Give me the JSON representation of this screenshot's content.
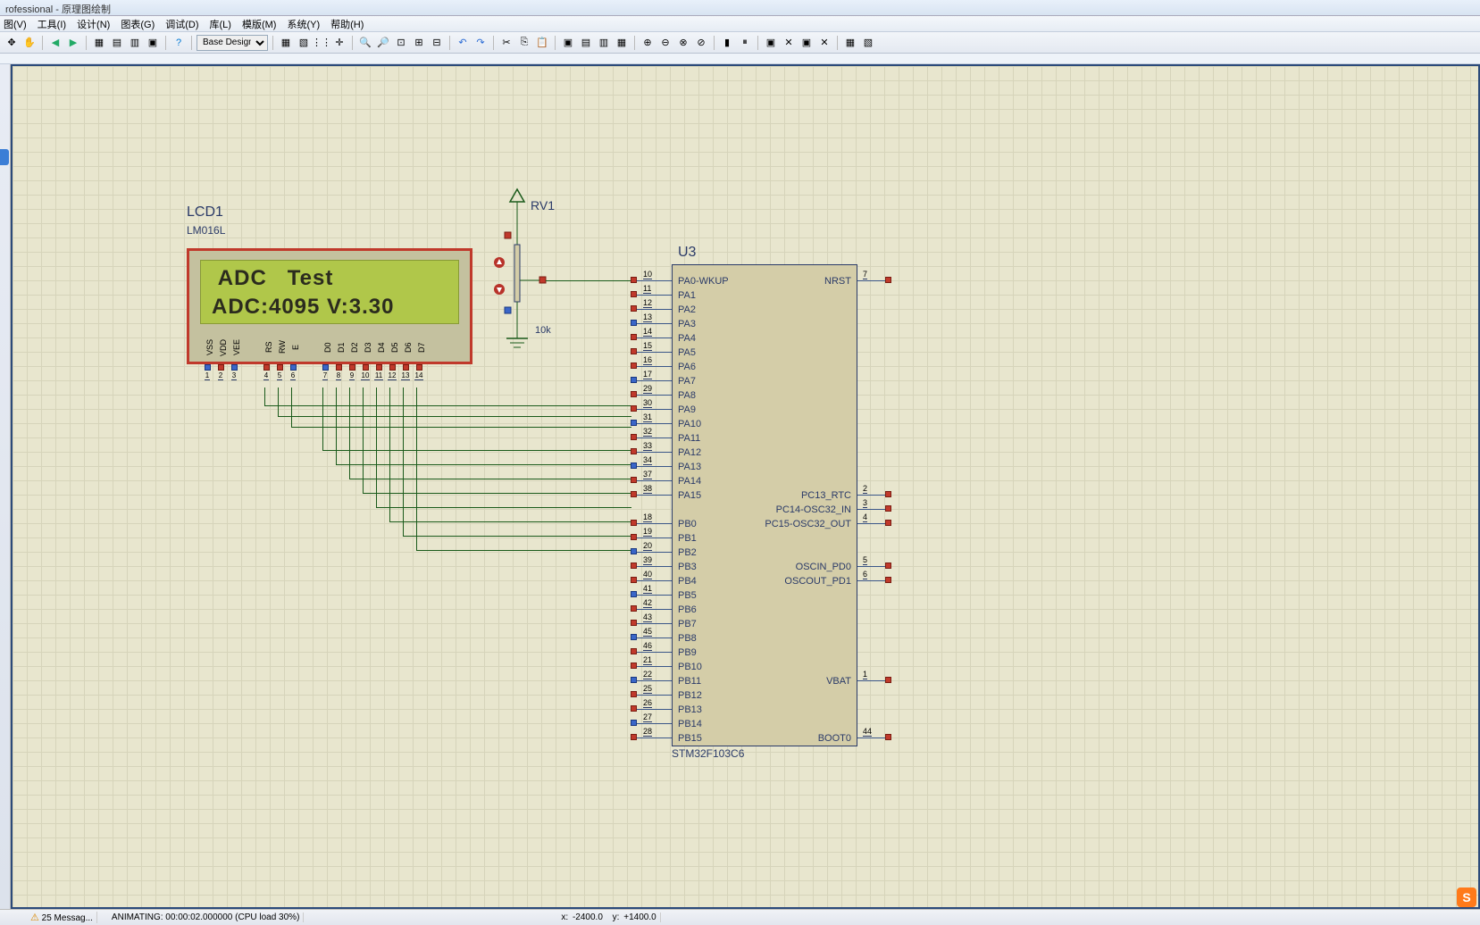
{
  "title": "rofessional - 原理图绘制",
  "menu": {
    "view": "图(V)",
    "tools": "工具(I)",
    "design": "设计(N)",
    "graph": "图表(G)",
    "debug": "调试(D)",
    "library": "库(L)",
    "template": "模版(M)",
    "system": "系统(Y)",
    "help": "帮助(H)"
  },
  "toolbar": {
    "design_select": "Base Design"
  },
  "schematic": {
    "lcd": {
      "ref": "LCD1",
      "part": "LM016L",
      "line1": " ADC   Test",
      "line2": "ADC:4095 V:3.30",
      "pins": [
        "VSS",
        "VDD",
        "VEE",
        "RS",
        "RW",
        "E",
        "D0",
        "D1",
        "D2",
        "D3",
        "D4",
        "D5",
        "D6",
        "D7"
      ],
      "pin_nums": [
        "1",
        "2",
        "3",
        "4",
        "5",
        "6",
        "7",
        "8",
        "9",
        "10",
        "11",
        "12",
        "13",
        "14"
      ]
    },
    "rv1": {
      "ref": "RV1",
      "value": "10k"
    },
    "u3": {
      "ref": "U3",
      "part": "STM32F103C6",
      "left_pins": [
        {
          "n": "10",
          "lbl": "PA0-WKUP"
        },
        {
          "n": "11",
          "lbl": "PA1"
        },
        {
          "n": "12",
          "lbl": "PA2"
        },
        {
          "n": "13",
          "lbl": "PA3"
        },
        {
          "n": "14",
          "lbl": "PA4"
        },
        {
          "n": "15",
          "lbl": "PA5"
        },
        {
          "n": "16",
          "lbl": "PA6"
        },
        {
          "n": "17",
          "lbl": "PA7"
        },
        {
          "n": "29",
          "lbl": "PA8"
        },
        {
          "n": "30",
          "lbl": "PA9"
        },
        {
          "n": "31",
          "lbl": "PA10"
        },
        {
          "n": "32",
          "lbl": "PA11"
        },
        {
          "n": "33",
          "lbl": "PA12"
        },
        {
          "n": "34",
          "lbl": "PA13"
        },
        {
          "n": "37",
          "lbl": "PA14"
        },
        {
          "n": "38",
          "lbl": "PA15"
        },
        {
          "n": "",
          "lbl": ""
        },
        {
          "n": "18",
          "lbl": "PB0"
        },
        {
          "n": "19",
          "lbl": "PB1"
        },
        {
          "n": "20",
          "lbl": "PB2"
        },
        {
          "n": "39",
          "lbl": "PB3"
        },
        {
          "n": "40",
          "lbl": "PB4"
        },
        {
          "n": "41",
          "lbl": "PB5"
        },
        {
          "n": "42",
          "lbl": "PB6"
        },
        {
          "n": "43",
          "lbl": "PB7"
        },
        {
          "n": "45",
          "lbl": "PB8"
        },
        {
          "n": "46",
          "lbl": "PB9"
        },
        {
          "n": "21",
          "lbl": "PB10"
        },
        {
          "n": "22",
          "lbl": "PB11"
        },
        {
          "n": "25",
          "lbl": "PB12"
        },
        {
          "n": "26",
          "lbl": "PB13"
        },
        {
          "n": "27",
          "lbl": "PB14"
        },
        {
          "n": "28",
          "lbl": "PB15"
        }
      ],
      "right_pins": [
        {
          "n": "7",
          "lbl": "NRST",
          "row": 0
        },
        {
          "n": "2",
          "lbl": "PC13_RTC",
          "row": 15
        },
        {
          "n": "3",
          "lbl": "PC14-OSC32_IN",
          "row": 16
        },
        {
          "n": "4",
          "lbl": "PC15-OSC32_OUT",
          "row": 17
        },
        {
          "n": "5",
          "lbl": "OSCIN_PD0",
          "row": 20
        },
        {
          "n": "6",
          "lbl": "OSCOUT_PD1",
          "row": 21
        },
        {
          "n": "1",
          "lbl": "VBAT",
          "row": 28
        },
        {
          "n": "44",
          "lbl": "BOOT0",
          "row": 32
        }
      ]
    }
  },
  "status": {
    "messages": "25 Messag...",
    "anim": "ANIMATING: 00:00:02.000000 (CPU load 30%)",
    "coords_x_lbl": "x:",
    "coords_x": "-2400.0",
    "coords_y_lbl": "y:",
    "coords_y": "+1400.0"
  }
}
